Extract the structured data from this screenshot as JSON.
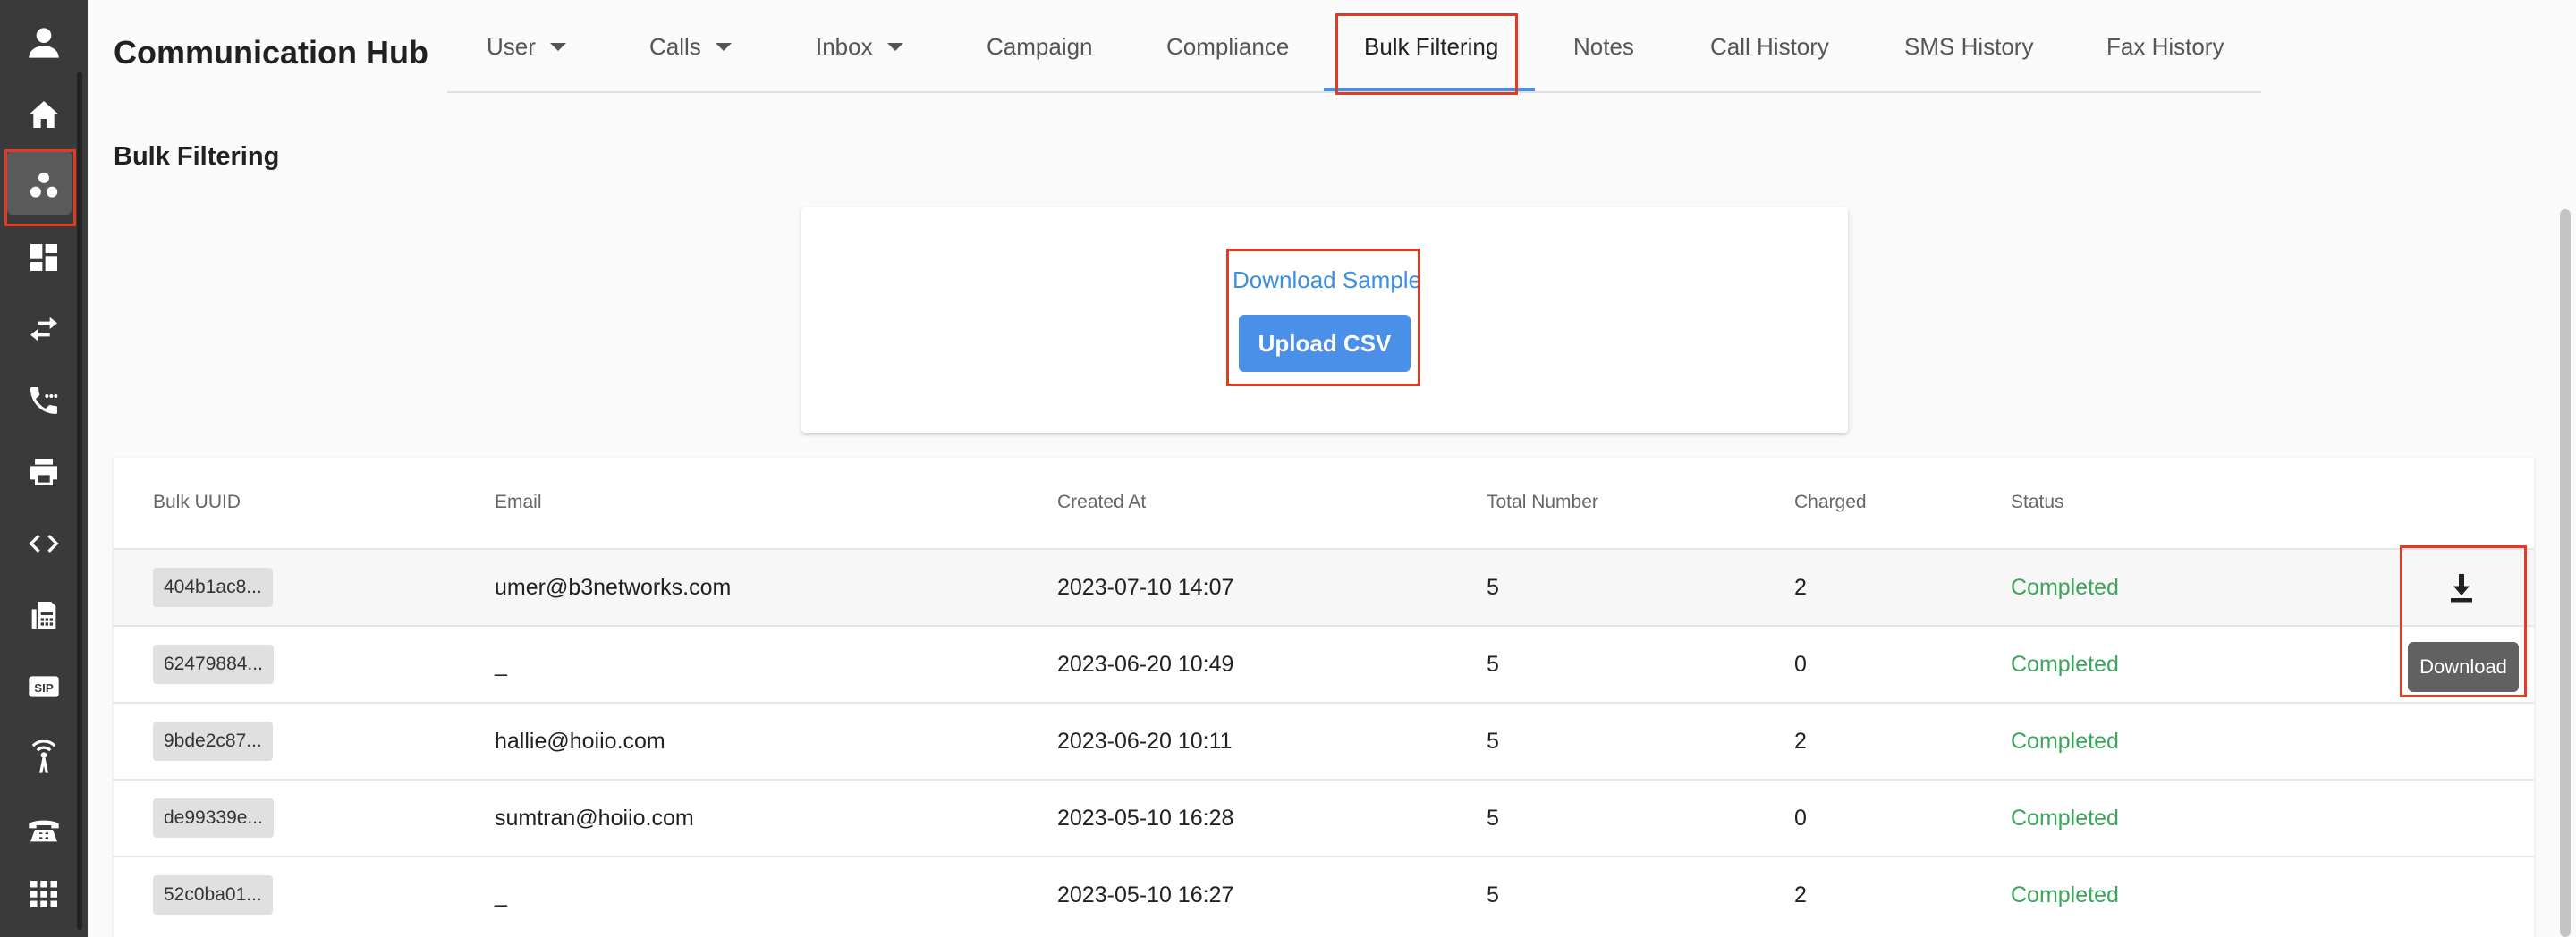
{
  "app": {
    "title": "Communication Hub"
  },
  "sidebar": {
    "items": [
      {
        "name": "user-avatar-icon"
      },
      {
        "name": "home-icon"
      },
      {
        "name": "communication-hub-icon",
        "active": true
      },
      {
        "name": "dashboard-icon"
      },
      {
        "name": "transfer-icon"
      },
      {
        "name": "phone-call-icon"
      },
      {
        "name": "printer-icon"
      },
      {
        "name": "code-icon"
      },
      {
        "name": "fax-icon"
      },
      {
        "name": "sip-icon",
        "label": "SIP"
      },
      {
        "name": "antenna-icon"
      },
      {
        "name": "desk-phone-icon"
      },
      {
        "name": "apps-grid-icon"
      }
    ]
  },
  "tabs": [
    {
      "label": "User",
      "dropdown": true
    },
    {
      "label": "Calls",
      "dropdown": true
    },
    {
      "label": "Inbox",
      "dropdown": true
    },
    {
      "label": "Campaign"
    },
    {
      "label": "Compliance"
    },
    {
      "label": "Bulk Filtering",
      "active": true
    },
    {
      "label": "Notes"
    },
    {
      "label": "Call History"
    },
    {
      "label": "SMS History"
    },
    {
      "label": "Fax History"
    }
  ],
  "page": {
    "title": "Bulk Filtering",
    "download_sample": "Download Sample",
    "upload_csv": "Upload CSV"
  },
  "table": {
    "columns": [
      "Bulk UUID",
      "Email",
      "Created At",
      "Total Number",
      "Charged",
      "Status"
    ],
    "rows": [
      {
        "uuid": "404b1ac8...",
        "email": "umer@b3networks.com",
        "created_at": "2023-07-10 14:07",
        "total": "5",
        "charged": "2",
        "status": "Completed"
      },
      {
        "uuid": "62479884...",
        "email": "_",
        "created_at": "2023-06-20 10:49",
        "total": "5",
        "charged": "0",
        "status": "Completed"
      },
      {
        "uuid": "9bde2c87...",
        "email": "hallie@hoiio.com",
        "created_at": "2023-06-20 10:11",
        "total": "5",
        "charged": "2",
        "status": "Completed"
      },
      {
        "uuid": "de99339e...",
        "email": "sumtran@hoiio.com",
        "created_at": "2023-05-10 16:28",
        "total": "5",
        "charged": "0",
        "status": "Completed"
      },
      {
        "uuid": "52c0ba01...",
        "email": "_",
        "created_at": "2023-05-10 16:27",
        "total": "5",
        "charged": "2",
        "status": "Completed"
      }
    ],
    "tooltip": "Download"
  },
  "colors": {
    "sidebar": "#3a3a3a",
    "accent": "#4a8fe8",
    "status_completed": "#3ba55c",
    "highlight": "#e03b24"
  }
}
